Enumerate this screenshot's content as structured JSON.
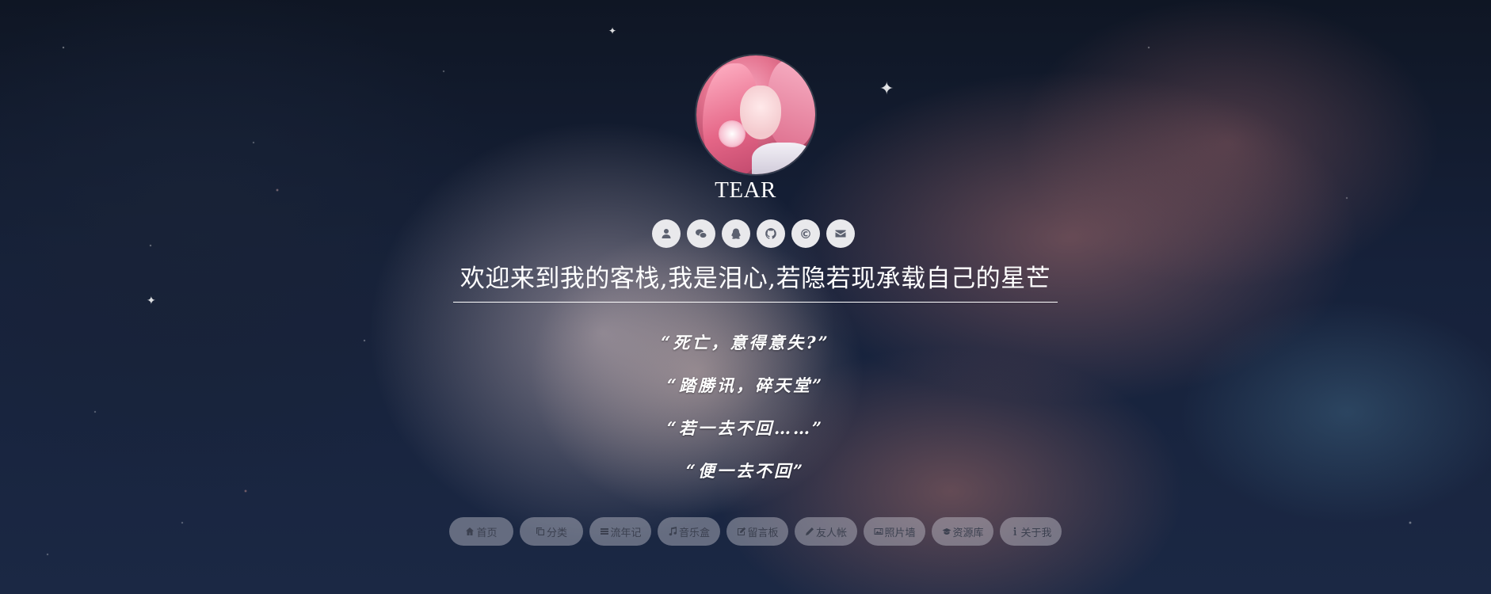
{
  "site": {
    "name": "TEAR",
    "welcome": "欢迎来到我的客栈,我是泪心,若隐若现承载自己的星芒"
  },
  "social": [
    {
      "icon": "user-icon"
    },
    {
      "icon": "wechat-icon"
    },
    {
      "icon": "qq-icon"
    },
    {
      "icon": "github-icon"
    },
    {
      "icon": "copyright-icon",
      "glyph": "©"
    },
    {
      "icon": "envelope-icon"
    }
  ],
  "poem": {
    "lines": [
      "“死亡，意得意失?”",
      "“踏勝讯，碎天堂”",
      "“若一去不回……”",
      "“便一去不回”"
    ]
  },
  "nav": {
    "items": [
      {
        "label": "首页",
        "icon": "home-icon"
      },
      {
        "label": "分类",
        "icon": "copy-icon"
      },
      {
        "label": "流年记",
        "icon": "list-icon"
      },
      {
        "label": "音乐盒",
        "icon": "music-icon"
      },
      {
        "label": "留言板",
        "icon": "edit-icon"
      },
      {
        "label": "友人帐",
        "icon": "pencil-icon"
      },
      {
        "label": "照片墙",
        "icon": "image-icon"
      },
      {
        "label": "资源库",
        "icon": "graduation-cap-icon"
      },
      {
        "label": "关于我",
        "icon": "info-icon"
      }
    ]
  },
  "colors": {
    "background": "#121a2b",
    "text": "#ffffff",
    "social_button": "#e9e9ec",
    "nav_button": "rgba(205,205,215,0.42)"
  }
}
